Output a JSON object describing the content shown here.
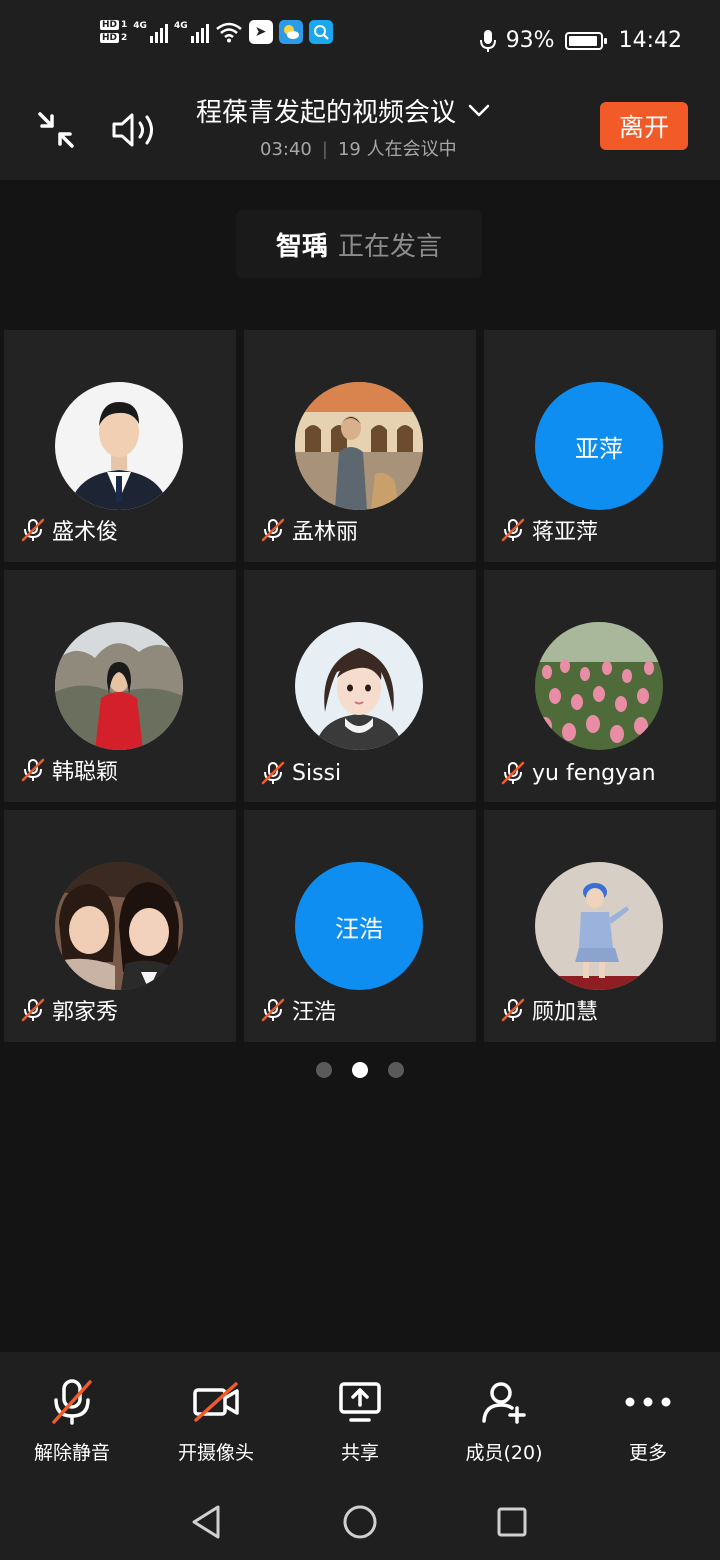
{
  "status_bar": {
    "hd_badges": [
      {
        "tag": "HD",
        "num": "1"
      },
      {
        "tag": "HD",
        "num": "2"
      }
    ],
    "network_labels": [
      "4G",
      "4G"
    ],
    "icons": [
      "wifi-icon",
      "sim-app-icon",
      "weather-icon",
      "search-app-icon",
      "mic-icon",
      "battery-icon"
    ],
    "battery_percent": "93%",
    "battery_level": 0.93,
    "time": "14:42"
  },
  "header": {
    "title": "程葆青发起的视频会议",
    "duration": "03:40",
    "separator": "|",
    "participant_text": "19 人在会议中",
    "leave_label": "离开",
    "accent_color": "#f25a27"
  },
  "speaker": {
    "name": "智瑀",
    "status": "正在发言"
  },
  "participants": [
    {
      "name": "盛术俊",
      "avatar": "photo"
    },
    {
      "name": "孟林丽",
      "avatar": "photo"
    },
    {
      "name": "蒋亚萍",
      "avatar": "initials",
      "initials": "亚萍"
    },
    {
      "name": "韩聪颖",
      "avatar": "photo"
    },
    {
      "name": "Sissi",
      "avatar": "photo"
    },
    {
      "name": "yu fengyan",
      "avatar": "photo"
    },
    {
      "name": "郭家秀",
      "avatar": "photo"
    },
    {
      "name": "汪浩",
      "avatar": "initials",
      "initials": "汪浩"
    },
    {
      "name": "顾加慧",
      "avatar": "photo"
    }
  ],
  "pagination": {
    "pages": 3,
    "current": 2
  },
  "toolbar": {
    "unmute": "解除静音",
    "camera": "开摄像头",
    "share": "共享",
    "members": "成员(20)",
    "more": "更多"
  },
  "colors": {
    "avatar_blue": "#0e8ef0",
    "muted_red": "#f25a27"
  }
}
